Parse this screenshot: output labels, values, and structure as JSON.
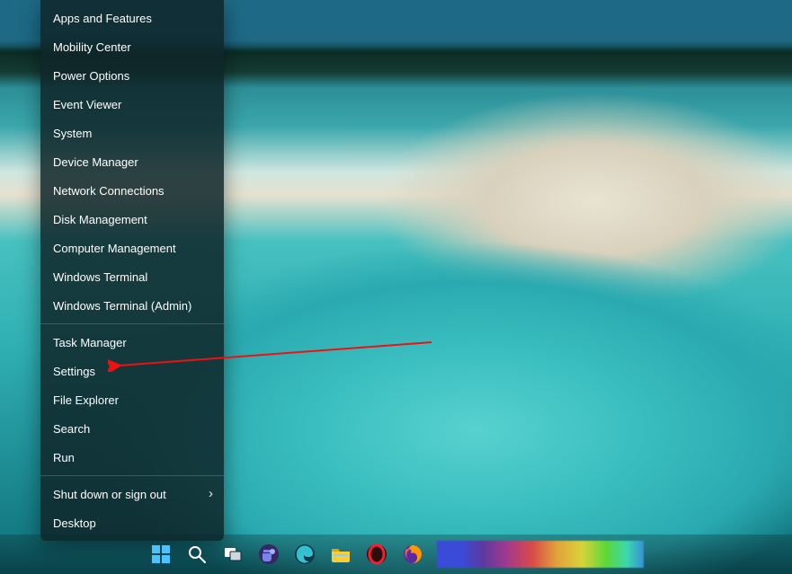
{
  "context_menu": {
    "items": [
      {
        "label": "Apps and Features"
      },
      {
        "label": "Mobility Center"
      },
      {
        "label": "Power Options"
      },
      {
        "label": "Event Viewer"
      },
      {
        "label": "System"
      },
      {
        "label": "Device Manager"
      },
      {
        "label": "Network Connections"
      },
      {
        "label": "Disk Management"
      },
      {
        "label": "Computer Management"
      },
      {
        "label": "Windows Terminal"
      },
      {
        "label": "Windows Terminal (Admin)"
      }
    ],
    "items2": [
      {
        "label": "Task Manager"
      },
      {
        "label": "Settings"
      },
      {
        "label": "File Explorer"
      },
      {
        "label": "Search"
      },
      {
        "label": "Run"
      }
    ],
    "items3": [
      {
        "label": "Shut down or sign out",
        "submenu": true
      },
      {
        "label": "Desktop"
      }
    ]
  },
  "annotation": {
    "arrow_color": "#e11",
    "target_item": "Settings"
  },
  "taskbar": {
    "buttons": [
      {
        "name": "start",
        "title": "Start",
        "color": "#4cc2ff"
      },
      {
        "name": "search",
        "title": "Search",
        "color": "#ffffff"
      },
      {
        "name": "task-view",
        "title": "Task View",
        "color": "#ffffff"
      },
      {
        "name": "teams",
        "title": "Chat",
        "color": "#7b83eb"
      },
      {
        "name": "edge",
        "title": "Microsoft Edge",
        "color": "#35c1d4"
      },
      {
        "name": "file-explorer",
        "title": "File Explorer",
        "color": "#ffcc33"
      },
      {
        "name": "opera",
        "title": "Opera",
        "color": "#ff1b2d"
      },
      {
        "name": "firefox",
        "title": "Firefox",
        "color": "#ff9500"
      }
    ]
  }
}
